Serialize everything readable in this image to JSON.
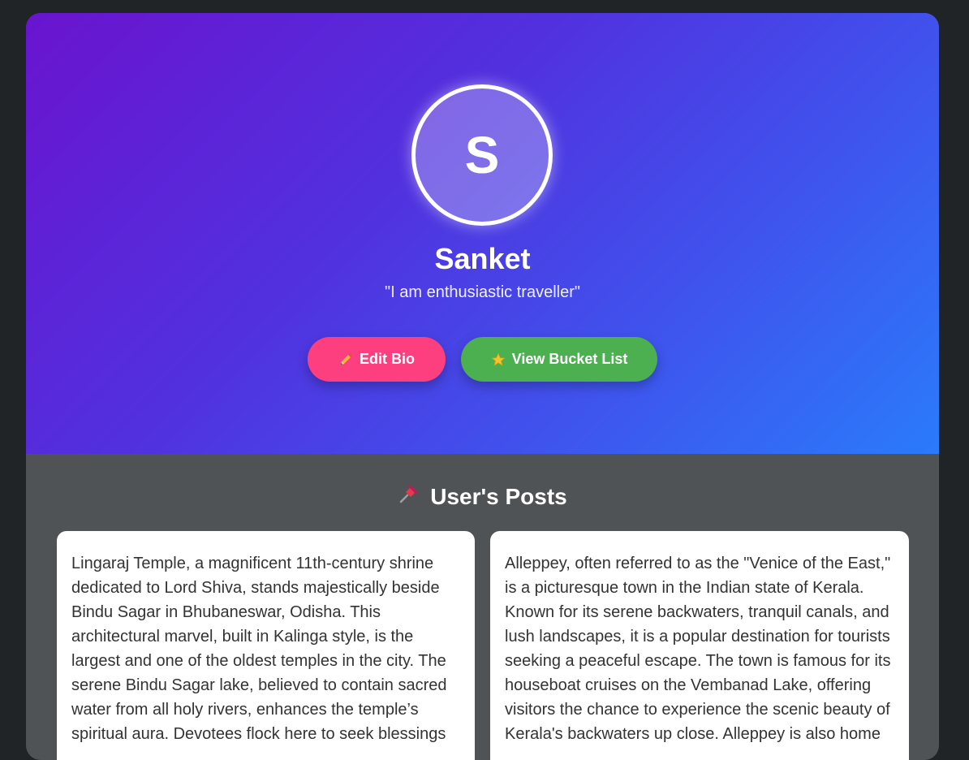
{
  "profile": {
    "avatar_initial": "S",
    "name": "Sanket",
    "bio": "\"I am enthusiastic traveller\""
  },
  "actions": {
    "edit_bio_label": "Edit Bio",
    "bucket_list_label": "View Bucket List"
  },
  "posts_section": {
    "title": "User's Posts",
    "icon": "pushpin-icon"
  },
  "posts": [
    {
      "text": "Lingaraj Temple, a magnificent 11th-century shrine dedicated to Lord Shiva, stands majestically beside Bindu Sagar in Bhubaneswar, Odisha. This architectural marvel, built in Kalinga style, is the largest and one of the oldest temples in the city. The serene Bindu Sagar lake, believed to contain sacred water from all holy rivers, enhances the temple’s spiritual aura. Devotees flock here to seek blessings"
    },
    {
      "text": "Alleppey, often referred to as the \"Venice of the East,\" is a picturesque town in the Indian state of Kerala. Known for its serene backwaters, tranquil canals, and lush landscapes, it is a popular destination for tourists seeking a peaceful escape. The town is famous for its houseboat cruises on the Vembanad Lake, offering visitors the chance to experience the scenic beauty of Kerala's backwaters up close. Alleppey is also home"
    }
  ],
  "colors": {
    "edit_button": "#fd3f7f",
    "bucket_button": "#4caf50",
    "gradient_start": "#6a14cf",
    "gradient_end": "#2a7bfb"
  }
}
